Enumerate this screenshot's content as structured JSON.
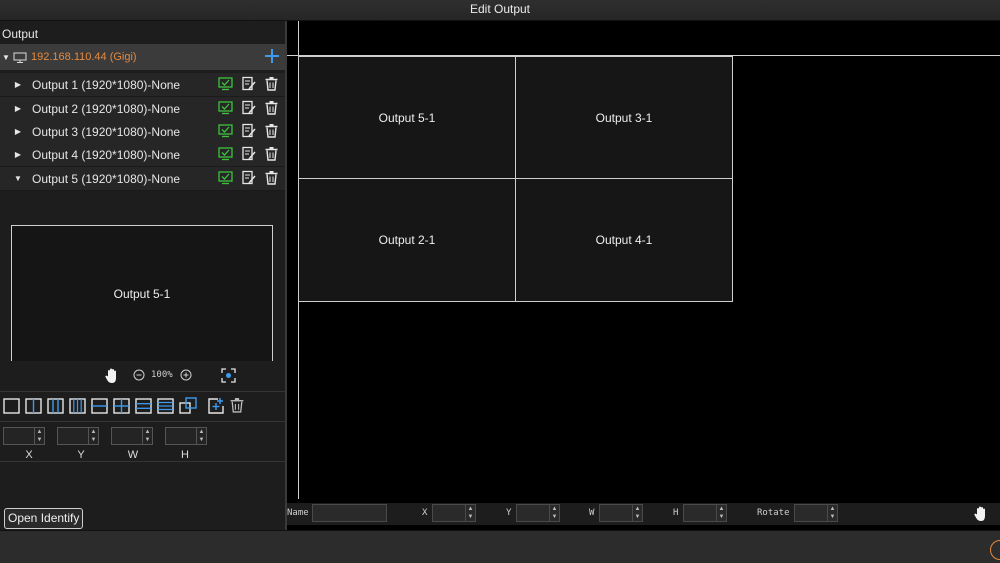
{
  "window": {
    "title": "Edit Output"
  },
  "output_panel": {
    "heading": "Output",
    "device": {
      "label": "192.168.110.44  (Gigi)"
    },
    "outputs": [
      {
        "label": "Output 1 (1920*1080)-None",
        "expanded": false
      },
      {
        "label": "Output 2 (1920*1080)-None",
        "expanded": false
      },
      {
        "label": "Output 3 (1920*1080)-None",
        "expanded": false
      },
      {
        "label": "Output 4 (1920*1080)-None",
        "expanded": false
      },
      {
        "label": "Output 5 (1920*1080)-None",
        "expanded": true
      }
    ],
    "preview": {
      "label": "Output 5-1"
    },
    "zoom": {
      "level": "100%"
    },
    "coords": {
      "x_label": "X",
      "y_label": "Y",
      "w_label": "W",
      "h_label": "H"
    },
    "open_identify_label": "Open Identify"
  },
  "canvas": {
    "cells": [
      {
        "label": "Output 5-1"
      },
      {
        "label": "Output 3-1"
      },
      {
        "label": "Output 2-1"
      },
      {
        "label": "Output 4-1"
      }
    ]
  },
  "bottom_fields": {
    "name_label": "Name",
    "x_label": "X",
    "y_label": "Y",
    "w_label": "W",
    "h_label": "H",
    "rotate_label": "Rotate"
  },
  "colors": {
    "accent": "#3e9bf0",
    "device": "#e58a3f",
    "ok": "#3ec23e"
  },
  "icons": {
    "device": "monitor-icon",
    "add": "plus-icon",
    "row": [
      "monitor-check-icon",
      "edit-icon",
      "trash-icon"
    ],
    "zoom": [
      "hand-icon",
      "zoom-out-icon",
      "zoom-in-icon",
      "fit-screen-icon"
    ],
    "layouts": [
      "layout-1x1-icon",
      "layout-1x2-icon",
      "layout-1x3-icon",
      "layout-1x4-icon",
      "layout-2x1-icon",
      "layout-2x2-icon",
      "layout-3x1-icon",
      "layout-4x1-icon",
      "layout-overlap-icon",
      "add-window-icon",
      "trash-icon"
    ]
  }
}
